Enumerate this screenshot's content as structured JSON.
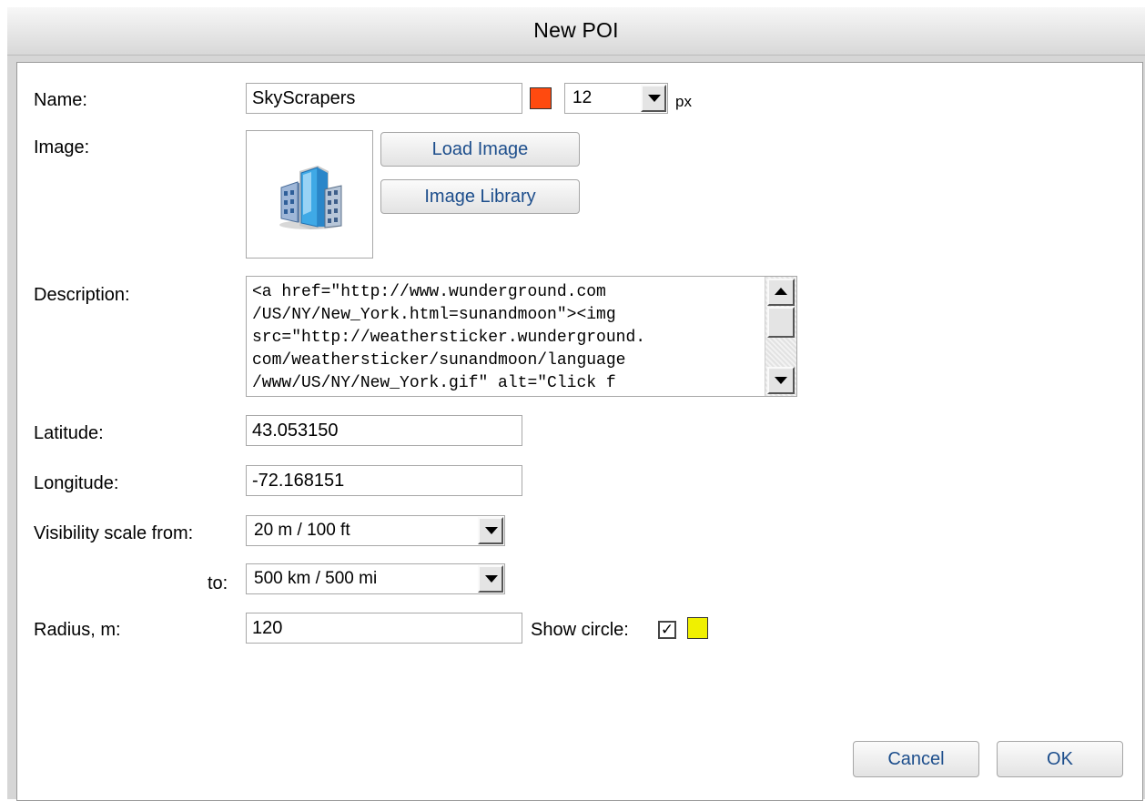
{
  "dialog": {
    "title": "New POI"
  },
  "name": {
    "label": "Name:",
    "value": "SkyScrapers",
    "color": "#ff4a0f",
    "size_value": "12",
    "size_unit": "px"
  },
  "image": {
    "label": "Image:",
    "icon": "skyscrapers-icon",
    "load_button": "Load Image",
    "library_button": "Image Library"
  },
  "description": {
    "label": "Description:",
    "lines": [
      "<a href=\"http://www.wunderground.com",
      "/US/NY/New_York.html=sunandmoon\"><img",
      "src=\"http://weathersticker.wunderground.",
      "com/weathersticker/sunandmoon/language",
      "/www/US/NY/New_York.gif\" alt=\"Click f"
    ]
  },
  "latitude": {
    "label": "Latitude:",
    "value": "43.053150"
  },
  "longitude": {
    "label": "Longitude:",
    "value": "-72.168151"
  },
  "visibility": {
    "from_label": "Visibility scale from:",
    "from_value": "20 m / 100 ft",
    "to_label": "to:",
    "to_value": "500 km / 500 mi"
  },
  "radius": {
    "label": "Radius, m:",
    "value": "120",
    "show_circle_label": "Show circle:",
    "show_circle_checked": true,
    "circle_color": "#f0f000"
  },
  "actions": {
    "cancel": "Cancel",
    "ok": "OK"
  }
}
